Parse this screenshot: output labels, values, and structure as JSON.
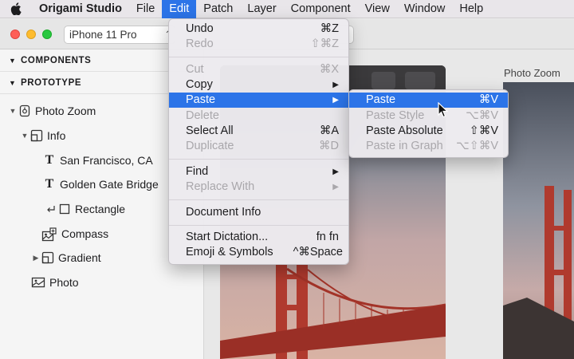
{
  "menubar": {
    "app": "Origami Studio",
    "items": [
      "File",
      "Edit",
      "Patch",
      "Layer",
      "Component",
      "View",
      "Window",
      "Help"
    ]
  },
  "window": {
    "device_select": "iPhone 11 Pro",
    "viewer_title": "Photo Zoom"
  },
  "sidebar": {
    "components_header": "COMPONENTS",
    "prototype_header": "PROTOTYPE",
    "tree": [
      {
        "label": "Photo Zoom"
      },
      {
        "label": "Info"
      },
      {
        "label": "San Francisco, CA"
      },
      {
        "label": "Golden Gate Bridge"
      },
      {
        "label": "Rectangle"
      },
      {
        "label": "Compass"
      },
      {
        "label": "Gradient"
      },
      {
        "label": "Photo"
      }
    ]
  },
  "edit_menu": {
    "items": [
      {
        "label": "Undo",
        "shortcut": "⌘Z"
      },
      {
        "label": "Redo",
        "shortcut": "⇧⌘Z"
      },
      {
        "label": "Cut",
        "shortcut": "⌘X"
      },
      {
        "label": "Copy",
        "shortcut": "▶"
      },
      {
        "label": "Paste",
        "shortcut": "▶"
      },
      {
        "label": "Delete",
        "shortcut": ""
      },
      {
        "label": "Select All",
        "shortcut": "⌘A"
      },
      {
        "label": "Duplicate",
        "shortcut": "⌘D"
      },
      {
        "label": "Find",
        "shortcut": "▶"
      },
      {
        "label": "Replace With",
        "shortcut": "▶"
      },
      {
        "label": "Document Info",
        "shortcut": ""
      },
      {
        "label": "Start Dictation...",
        "shortcut": "fn fn"
      },
      {
        "label": "Emoji & Symbols",
        "shortcut": "^⌘Space"
      }
    ]
  },
  "paste_submenu": {
    "items": [
      {
        "label": "Paste",
        "shortcut": "⌘V"
      },
      {
        "label": "Paste Style",
        "shortcut": "⌥⌘V"
      },
      {
        "label": "Paste Absolute",
        "shortcut": "⇧⌘V"
      },
      {
        "label": "Paste in Graph",
        "shortcut": "⌥⇧⌘V"
      }
    ]
  },
  "colors": {
    "selection": "#2c74e8",
    "bridge_red": "#c0392b"
  }
}
